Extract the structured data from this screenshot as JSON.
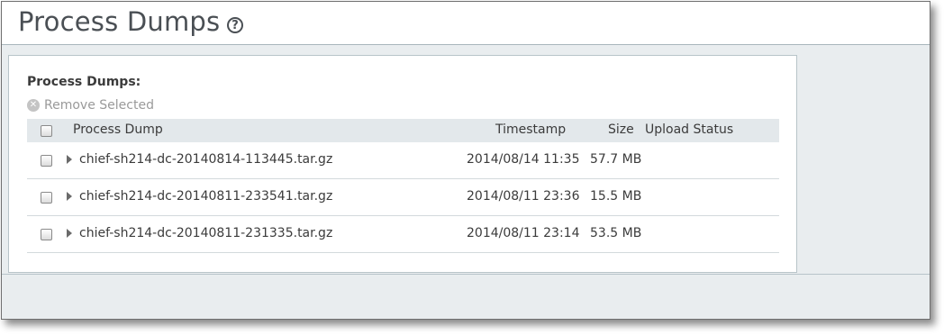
{
  "header": {
    "title": "Process Dumps"
  },
  "panel": {
    "title": "Process Dumps:",
    "remove_label": "Remove Selected"
  },
  "table": {
    "columns": {
      "process_dump": "Process Dump",
      "timestamp": "Timestamp",
      "size": "Size",
      "upload_status": "Upload Status"
    },
    "rows": [
      {
        "name": "chief-sh214-dc-20140814-113445.tar.gz",
        "timestamp": "2014/08/14 11:35",
        "size": "57.7 MB",
        "upload_status": ""
      },
      {
        "name": "chief-sh214-dc-20140811-233541.tar.gz",
        "timestamp": "2014/08/11 23:36",
        "size": "15.5 MB",
        "upload_status": ""
      },
      {
        "name": "chief-sh214-dc-20140811-231335.tar.gz",
        "timestamp": "2014/08/11 23:14",
        "size": "53.5 MB",
        "upload_status": ""
      }
    ]
  }
}
